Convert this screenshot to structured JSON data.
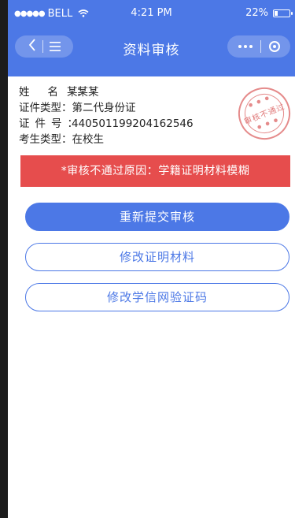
{
  "status_bar": {
    "signal": "●●●●●",
    "carrier": "BELL",
    "time": "4:21 PM",
    "battery_percent": "22%",
    "battery_level": 0.22
  },
  "nav": {
    "title": "资料审核",
    "back_label": "<",
    "menu_label": "≡"
  },
  "info": {
    "name_label": "姓名：",
    "name_value": "某某某",
    "id_type_label": "证件类型：",
    "id_type_value": "第二代身份证",
    "id_no_label": "证件号：",
    "id_no_value": "440501199204162546",
    "candidate_type_label": "考生类型：",
    "candidate_type_value": "在校生"
  },
  "stamp": {
    "text": "审核不通过"
  },
  "failure": {
    "message": "*审核不通过原因：学籍证明材料模糊"
  },
  "actions": {
    "resubmit": "重新提交审核",
    "modify_materials": "修改证明材料",
    "modify_code": "修改学信网验证码"
  },
  "colors": {
    "primary": "#4c78e6",
    "danger": "#e64d4d",
    "stamp": "#e58b8b"
  }
}
